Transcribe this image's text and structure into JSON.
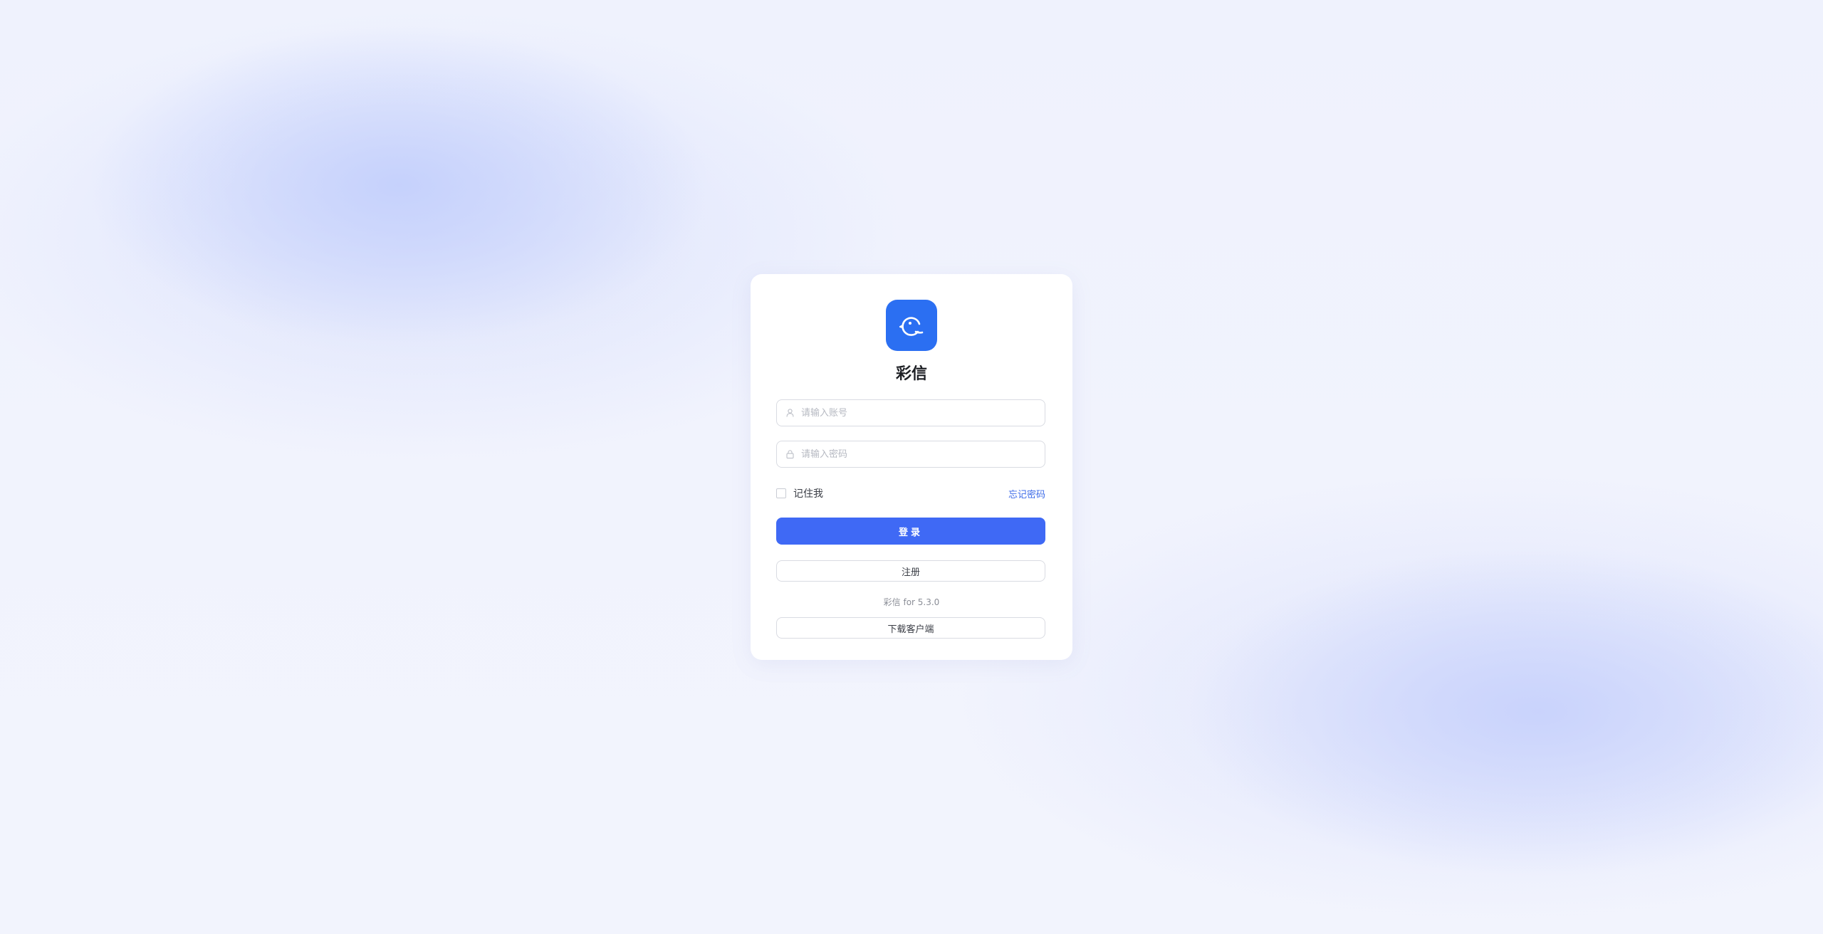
{
  "app": {
    "name": "彩信",
    "logo_icon": "chat-bird-icon",
    "brand_color": "#2b6ff2"
  },
  "login_form": {
    "account_placeholder": "请输入账号",
    "password_placeholder": "请输入密码",
    "remember_label": "记住我",
    "remember_checked": false,
    "forgot_label": "忘记密码",
    "login_label": "登录",
    "register_label": "注册"
  },
  "footer": {
    "version_text": "彩信 for 5.3.0",
    "download_label": "下载客户端"
  },
  "colors": {
    "primary_button": "#3f69f5",
    "link": "#3d6be8"
  }
}
